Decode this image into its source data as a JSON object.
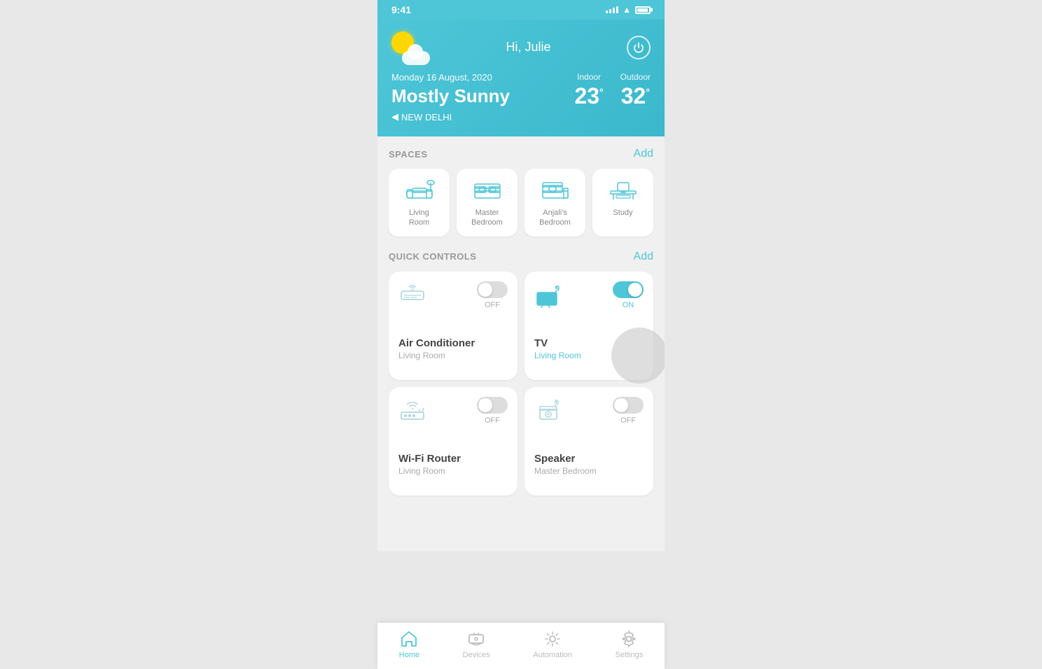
{
  "statusBar": {
    "time": "9:41"
  },
  "header": {
    "greeting": "Hi, Julie",
    "date": "Monday 16 August, 2020",
    "weather": "Mostly Sunny",
    "location": "NEW DELHI",
    "indoor": {
      "label": "Indoor",
      "value": "23",
      "unit": "°"
    },
    "outdoor": {
      "label": "Outdoor",
      "value": "32",
      "unit": "°"
    }
  },
  "spaces": {
    "title": "SPACES",
    "addLabel": "Add",
    "items": [
      {
        "id": "living-room",
        "label": "Living\nRoom"
      },
      {
        "id": "master-bedroom",
        "label": "Master\nBedroom"
      },
      {
        "id": "anjalis-bedroom",
        "label": "Anjali's\nBedroom"
      },
      {
        "id": "study",
        "label": "Study"
      }
    ]
  },
  "quickControls": {
    "title": "QUICK CONTROLS",
    "addLabel": "Add",
    "items": [
      {
        "id": "ac",
        "name": "Air Conditioner",
        "room": "Living Room",
        "state": "off",
        "stateLabel": "OFF",
        "iconType": "ac"
      },
      {
        "id": "tv",
        "name": "TV",
        "room": "Living Room",
        "state": "on",
        "stateLabel": "ON",
        "iconType": "tv",
        "roomActive": true
      },
      {
        "id": "wifi",
        "name": "Wi-Fi Router",
        "room": "Living Room",
        "state": "off",
        "stateLabel": "OFF",
        "iconType": "wifi"
      },
      {
        "id": "speaker",
        "name": "Speaker",
        "room": "Master Bedroom",
        "state": "off",
        "stateLabel": "OFF",
        "iconType": "speaker"
      }
    ]
  },
  "bottomNav": [
    {
      "id": "home",
      "label": "Home",
      "active": true
    },
    {
      "id": "devices",
      "label": "Devices",
      "active": false
    },
    {
      "id": "automation",
      "label": "Automation",
      "active": false
    },
    {
      "id": "settings",
      "label": "Settings",
      "active": false
    }
  ]
}
